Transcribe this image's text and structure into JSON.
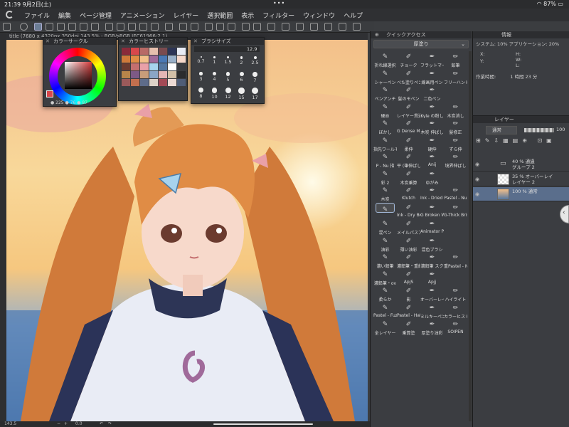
{
  "status": {
    "time": "21:39",
    "date": "9月2日(土)",
    "dots": "•••",
    "battery": "87%"
  },
  "menu": [
    "ファイル",
    "編集",
    "ページ管理",
    "アニメーション",
    "レイヤー",
    "選択範囲",
    "表示",
    "フィルター",
    "ウィンドウ",
    "ヘルプ"
  ],
  "canvas": {
    "title": "title (7680 x 4320px 350dpi 143.5% - RGB/sRGB IEC61966-2.1)"
  },
  "color_circle": {
    "title": "カラーサークル",
    "h": "225",
    "s": "76",
    "v": "87"
  },
  "color_history": {
    "title": "カラーヒストリー"
  },
  "brush_size": {
    "title": "ブラシサイズ",
    "value": "12.9",
    "sizes": [
      "0.7",
      "1",
      "1.5",
      "2",
      "2.5",
      "3",
      "4",
      "5",
      "6",
      "7",
      "8",
      "10",
      "12",
      "15",
      "17"
    ]
  },
  "quick": {
    "title": "クイックアクセス",
    "set": "厚塗り",
    "items": [
      "折れ線選択",
      "チョーク",
      "フラットマー",
      "鉛筆",
      "シャーペン",
      "べた塗りペン",
      "線画用ペン",
      "フリーハンド",
      "ペンアンチ",
      "髪のモペン",
      "二色ペン",
      "",
      "硬め",
      "レイヤー貫通",
      "Kyle の粉し",
      "木炭消し",
      "ぼかし",
      "G Dense Mix",
      "木炭 伸ばし",
      "髪修正",
      "指先ワールモ",
      "柔伸",
      "硬伸",
      "ずら伸",
      "P - Nu 指",
      "平 (筆伸ばし)",
      "Anij",
      "境界伸ばし",
      "彩 2",
      "木炭乗算",
      "ゆがみ",
      "",
      "木炭",
      "Klutch",
      "Ink - Dried C",
      "Pastel - Nu",
      "Pastel - Nu",
      "Ink - Dry Bru",
      "G Broken W",
      "G-Thick Bris",
      "混ペン",
      "メイルパスブ",
      "Animator Pe",
      "",
      "油彩",
      "薄い油彩",
      "混色ブラシ",
      "",
      "濃い鉛筆",
      "濃鉛筆・重線",
      "濃鉛筆 スク",
      "重Pastel - Nu",
      "濃鉛筆・ov",
      "ApjS",
      "Apjj",
      "",
      "柔らか",
      "影",
      "オーバーレイ",
      "ハイライト",
      "Pastel - Fuzz",
      "Pastel - Hate",
      "ミルキーペン",
      "カラーヒスト",
      "全レイヤー",
      "乗算塗",
      "厚塗り油彩",
      "SOIPEN"
    ]
  },
  "info": {
    "title": "情報",
    "system": "システム: 10%",
    "application": "アプリケーション: 20%",
    "x": "X:",
    "y": "Y:",
    "w": "W:",
    "h": "H:",
    "l": "L:",
    "time_label": "作業時間:",
    "time_value": "1 時間 23 分"
  },
  "layers": {
    "title": "レイヤー",
    "blend": "通常",
    "opacity": "100",
    "items": [
      {
        "line1": "40 % 通過",
        "line2": "グループ 2"
      },
      {
        "line1": "35 % オーバーレイ",
        "line2": "レイヤー 2"
      },
      {
        "line1": "100 % 通常",
        "line2": ""
      }
    ]
  },
  "bottom": {
    "zoom": "143.5",
    "angle": "0.0"
  },
  "colors": {
    "accent": "#5a6e8c",
    "panel": "#3b3d41",
    "dark": "#2c2d30"
  }
}
